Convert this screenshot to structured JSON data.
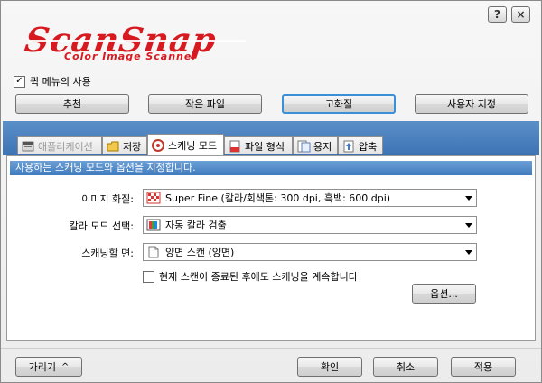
{
  "window": {
    "help_label": "?",
    "close_label": "×"
  },
  "logo": {
    "brand": "ScanSnap",
    "subtitle": "Color Image Scanner",
    "color": "#d71920"
  },
  "quick_menu": {
    "label": "퀵 메뉴의 사용",
    "checked": true,
    "check_mark": "✓"
  },
  "presets": [
    {
      "label": "추천",
      "selected": false
    },
    {
      "label": "작은 파일",
      "selected": false
    },
    {
      "label": "고화질",
      "selected": true
    },
    {
      "label": "사용자 지정",
      "selected": false
    }
  ],
  "tabs": [
    {
      "label": "애플리케이션",
      "icon": "application-icon",
      "state": "disabled"
    },
    {
      "label": "저장",
      "icon": "folder-icon",
      "state": "normal"
    },
    {
      "label": "스캐닝 모드",
      "icon": "scan-mode-icon",
      "state": "active"
    },
    {
      "label": "파일 형식",
      "icon": "file-format-icon",
      "state": "normal"
    },
    {
      "label": "용지",
      "icon": "paper-icon",
      "state": "normal"
    },
    {
      "label": "압축",
      "icon": "compression-icon",
      "state": "normal"
    }
  ],
  "panel": {
    "description": "사용하는 스캐닝 모드와 옵션을 지정합니다.",
    "image_quality": {
      "label": "이미지 화질:",
      "value": "Super Fine (칼라/회색톤: 300 dpi, 흑백: 600 dpi)",
      "icon": "checker-icon"
    },
    "color_mode": {
      "label": "칼라 모드 선택:",
      "value": "자동 칼라 검출",
      "icon": "color-mode-icon"
    },
    "scan_side": {
      "label": "스캐닝할 면:",
      "value": "양면 스캔 (양면)",
      "icon": "duplex-icon"
    },
    "continue_scan": {
      "label": "현재 스캔이 종료된 후에도 스캐닝을 계속합니다",
      "checked": false
    },
    "options_button": "옵션..."
  },
  "footer": {
    "hide_button": "가리기",
    "hide_arrow": "^",
    "ok_button": "확인",
    "cancel_button": "취소",
    "apply_button": "적용"
  },
  "colors": {
    "tab_strip": "#4a82c0",
    "panel_header": "#5890cc",
    "selected_border": "#3b8ed8"
  }
}
